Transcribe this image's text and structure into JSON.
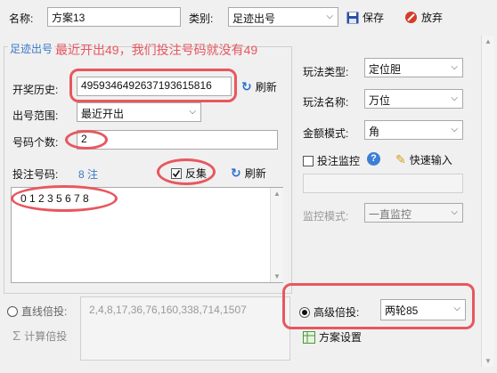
{
  "toolbar": {
    "name_label": "名称:",
    "name_value": "方案13",
    "category_label": "类别:",
    "category_value": "足迹出号",
    "save_label": "保存",
    "abandon_label": "放弃"
  },
  "left_panel": {
    "group_title": "足迹出号",
    "annotation": "最近开出49，我们投注号码就没有49",
    "history_label": "开奖历史:",
    "history_value": "4959346492637193615816",
    "refresh1_label": "刷新",
    "range_label": "出号范围:",
    "range_value": "最近开出",
    "count_label": "号码个数:",
    "count_value": "2",
    "bet_numbers_label": "投注号码:",
    "bet_count": "8 注",
    "reverse_label": "反集",
    "refresh2_label": "刷新",
    "numbers_value": "0 1 2 3 5 6 7 8"
  },
  "right_panel": {
    "play_type_label": "玩法类型:",
    "play_type_value": "定位胆",
    "play_name_label": "玩法名称:",
    "play_name_value": "万位",
    "amount_mode_label": "金额模式:",
    "amount_mode_value": "角",
    "monitor_label": "投注监控",
    "quick_input_label": "快速输入",
    "monitor_mode_label": "监控模式:",
    "monitor_mode_value": "一直监控"
  },
  "bottom": {
    "linear_label": "直线倍投:",
    "linear_value": "2,4,8,17,36,76,160,338,714,1507",
    "calc_label": "计算倍投",
    "advanced_label": "高级倍投:",
    "advanced_value": "两轮85",
    "scheme_label": "方案设置"
  },
  "colors": {
    "annotation_red": "#e8575f",
    "link_blue": "#2a6fd0",
    "title_blue": "#3a78c8"
  }
}
